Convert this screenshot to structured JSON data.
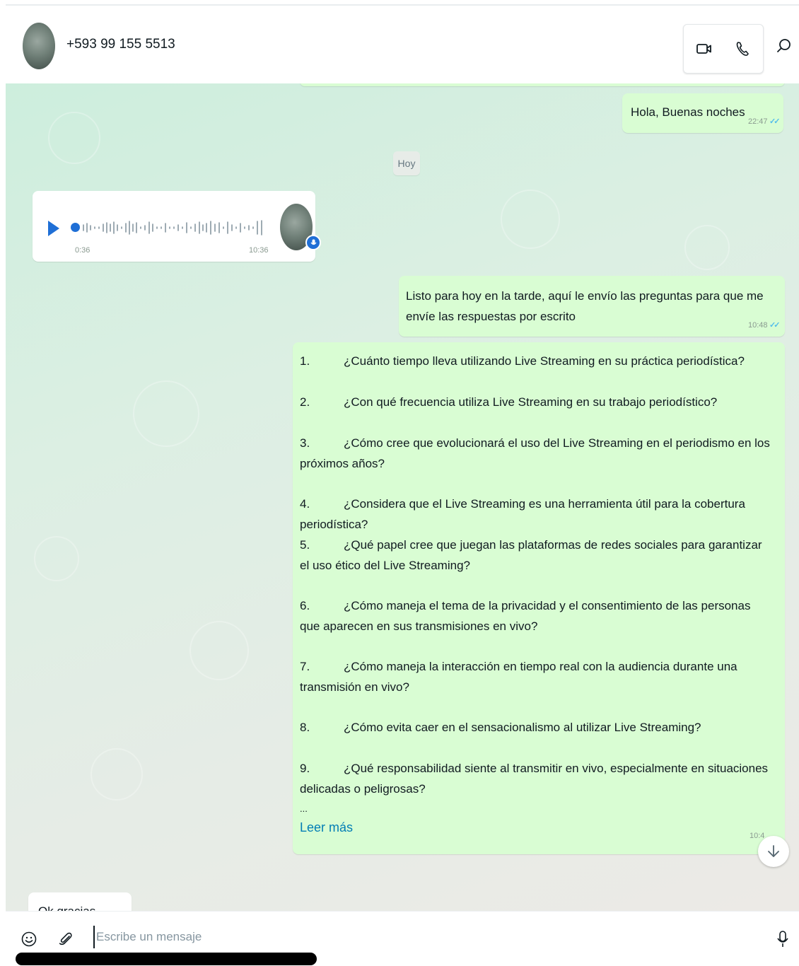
{
  "header": {
    "contact_name": "+593 99 155 5513",
    "icons": [
      "video-call-icon",
      "voice-call-icon",
      "search-icon"
    ]
  },
  "chat": {
    "messages": [
      {
        "type": "outgoing",
        "text": "Hola, Buenas noches",
        "time": "22:47",
        "status": "read"
      },
      {
        "type": "date",
        "text": "Hoy"
      },
      {
        "type": "incoming-voice",
        "elapsed": "0:36",
        "time": "10:36"
      },
      {
        "type": "outgoing",
        "text": "Listo para hoy en la tarde, aquí le envío las preguntas para que me envíe las respuestas por escrito",
        "time": "10:48",
        "status": "read"
      },
      {
        "type": "outgoing-list",
        "items": [
          {
            "num": "1.",
            "text": "¿Cuánto tiempo lleva utilizando Live Streaming en su práctica periodística?"
          },
          {
            "num": "2.",
            "text": "¿Con qué frecuencia utiliza Live Streaming en su trabajo periodístico?"
          },
          {
            "num": "3.",
            "text": "¿Cómo cree que evolucionará el uso del Live Streaming en el periodismo en los próximos años?"
          },
          {
            "num": "4.",
            "text": "¿Considera que el Live Streaming es una herramienta útil para la cobertura periodística?"
          },
          {
            "num": "5.",
            "text": "¿Qué papel cree que juegan las plataformas de redes sociales para garantizar el uso ético del Live Streaming?"
          },
          {
            "num": "6.",
            "text": "¿Cómo maneja el tema de la privacidad y el consentimiento de las personas que aparecen en sus transmisiones en vivo?"
          },
          {
            "num": "7.",
            "text": "¿Cómo maneja la interacción en tiempo real con la audiencia durante una transmisión en vivo?"
          },
          {
            "num": "8.",
            "text": "¿Cómo evita caer en el sensacionalismo al utilizar Live Streaming?"
          },
          {
            "num": "9.",
            "text": "¿Qué responsabilidad siente al transmitir en vivo, especialmente en situaciones delicadas o peligrosas?"
          }
        ],
        "ellipsis": "...",
        "read_more": "Leer más",
        "time": "10:4"
      },
      {
        "type": "incoming",
        "text": "Ok gracias"
      }
    ],
    "scroll_down_icon": "arrow-down-icon"
  },
  "composer": {
    "placeholder": "Escribe un mensaje",
    "icons": [
      "emoji-icon",
      "attach-icon",
      "microphone-icon"
    ]
  },
  "colors": {
    "outgoing_bubble": "#d9fdd3",
    "incoming_bubble": "#ffffff",
    "read_ticks": "#53bdeb",
    "link": "#027eb5",
    "play_accent": "#1f6fd6"
  }
}
